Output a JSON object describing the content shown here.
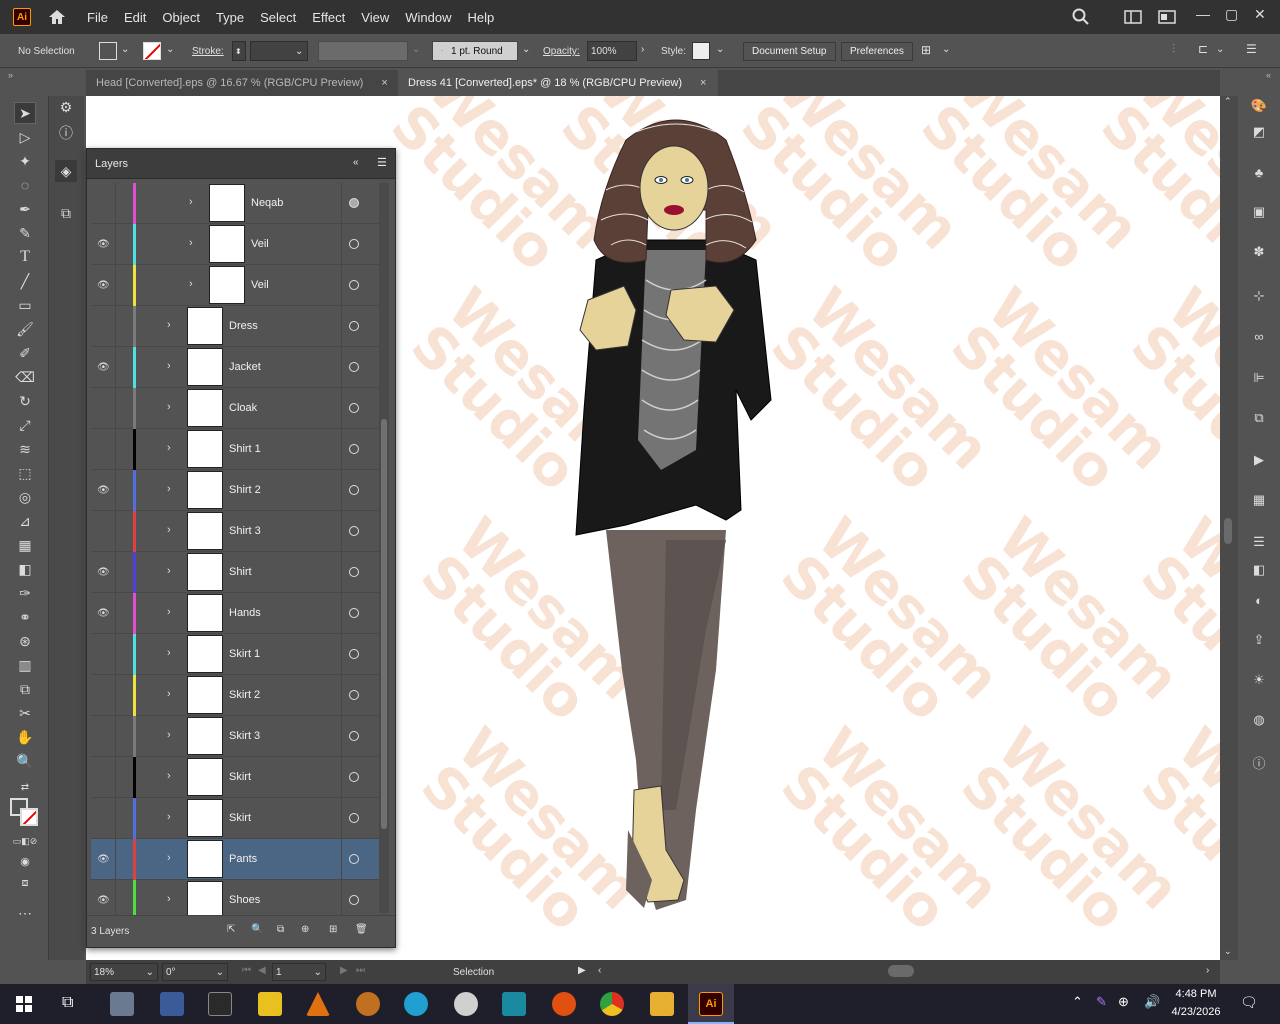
{
  "app": {
    "logo": "Ai"
  },
  "menu": [
    "File",
    "Edit",
    "Object",
    "Type",
    "Select",
    "Effect",
    "View",
    "Window",
    "Help"
  ],
  "control": {
    "selection": "No Selection",
    "stroke_label": "Stroke:",
    "brush": "1 pt. Round",
    "opacity_label": "Opacity:",
    "opacity_value": "100%",
    "style_label": "Style:",
    "doc_setup": "Document Setup",
    "preferences": "Preferences"
  },
  "tabs": [
    {
      "label": "Head [Converted].eps @ 16.67 % (RGB/CPU Preview)",
      "close": "×"
    },
    {
      "label": "Dress 41 [Converted].eps* @ 18 % (RGB/CPU Preview)",
      "close": "×"
    }
  ],
  "layers_panel": {
    "title": "Layers",
    "footer": "3 Layers",
    "rows": [
      {
        "name": "Neqab",
        "visible": false,
        "color": "#e04fd0"
      },
      {
        "name": "Veil",
        "visible": true,
        "color": "#4fe0e0"
      },
      {
        "name": "Veil",
        "visible": true,
        "color": "#f0e040"
      },
      {
        "name": "Dress",
        "visible": false,
        "color": "#7a7a7a"
      },
      {
        "name": "Jacket",
        "visible": true,
        "color": "#4fe0e0"
      },
      {
        "name": "Cloak",
        "visible": false,
        "color": "#7a7a7a"
      },
      {
        "name": "Shirt 1",
        "visible": false,
        "color": "#000000"
      },
      {
        "name": "Shirt 2",
        "visible": true,
        "color": "#4f70e0"
      },
      {
        "name": "Shirt 3",
        "visible": false,
        "color": "#e04040"
      },
      {
        "name": "Shirt",
        "visible": true,
        "color": "#4f40e0"
      },
      {
        "name": "Hands",
        "visible": true,
        "color": "#e04fd0"
      },
      {
        "name": "Skirt 1",
        "visible": false,
        "color": "#4fe0e0"
      },
      {
        "name": "Skirt 2",
        "visible": false,
        "color": "#f0e040"
      },
      {
        "name": "Skirt 3",
        "visible": false,
        "color": "#7a7a7a"
      },
      {
        "name": "Skirt",
        "visible": false,
        "color": "#000000"
      },
      {
        "name": "Skirt",
        "visible": false,
        "color": "#4f70e0"
      },
      {
        "name": "Pants",
        "visible": true,
        "color": "#e04040",
        "selected": true
      },
      {
        "name": "Shoes",
        "visible": true,
        "color": "#4fe040"
      }
    ]
  },
  "status": {
    "zoom": "18%",
    "rotation": "0°",
    "artboard": "1",
    "tool": "Selection"
  },
  "watermark": "Wesam\nStudio",
  "taskbar": {
    "time": "4:48 PM",
    "date": "4/23/2026"
  }
}
